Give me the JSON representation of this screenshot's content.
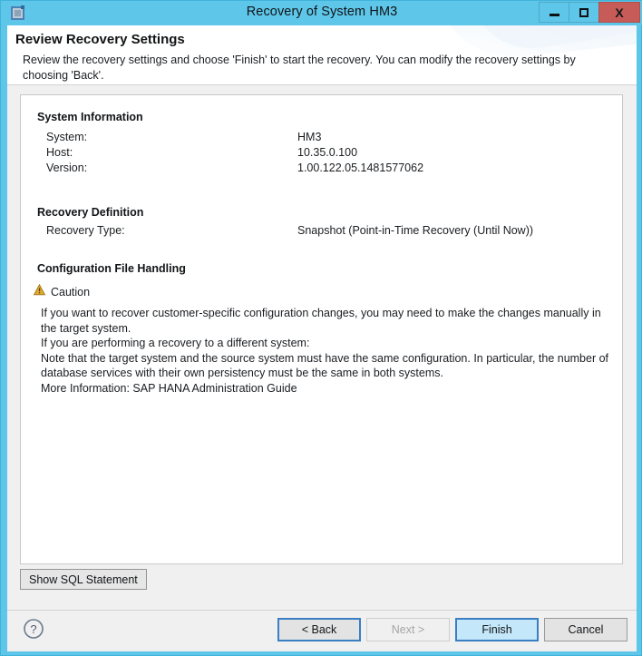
{
  "window": {
    "title": "Recovery of System HM3",
    "app_icon": "application-icon",
    "controls": {
      "minimize": "minimize-icon",
      "maximize": "maximize-icon",
      "close": "X"
    },
    "frame_color": "#5ec6e8",
    "close_color": "#c75b57"
  },
  "header": {
    "title": "Review Recovery Settings",
    "subtitle": "Review the recovery settings and choose 'Finish' to start the recovery. You can modify the recovery settings by choosing 'Back'."
  },
  "content": {
    "system_information": {
      "heading": "System Information",
      "rows": [
        {
          "label": "System:",
          "value": "HM3"
        },
        {
          "label": "Host:",
          "value": "10.35.0.100"
        },
        {
          "label": "Version:",
          "value": "1.00.122.05.1481577062"
        }
      ]
    },
    "recovery_definition": {
      "heading": "Recovery Definition",
      "rows": [
        {
          "label": "Recovery Type:",
          "value": "Snapshot (Point-in-Time Recovery (Until Now))"
        }
      ]
    },
    "configuration_file_handling": {
      "heading": "Configuration File Handling",
      "caution_label": "Caution",
      "caution_icon": "warning-icon",
      "caution_color": "#d9a520",
      "paragraphs": [
        "If you want to recover customer-specific configuration changes, you may need to make the changes manually in the target system.",
        "If you are performing a recovery to a different system:",
        "Note that the target system and the source system must have the same configuration. In particular, the number of database services with their own persistency must be the same in both systems.",
        "More Information: SAP HANA Administration Guide"
      ]
    }
  },
  "actions": {
    "show_sql": "Show SQL Statement",
    "help_icon": "help-icon",
    "back": "< Back",
    "next": "Next >",
    "finish": "Finish",
    "cancel": "Cancel"
  }
}
